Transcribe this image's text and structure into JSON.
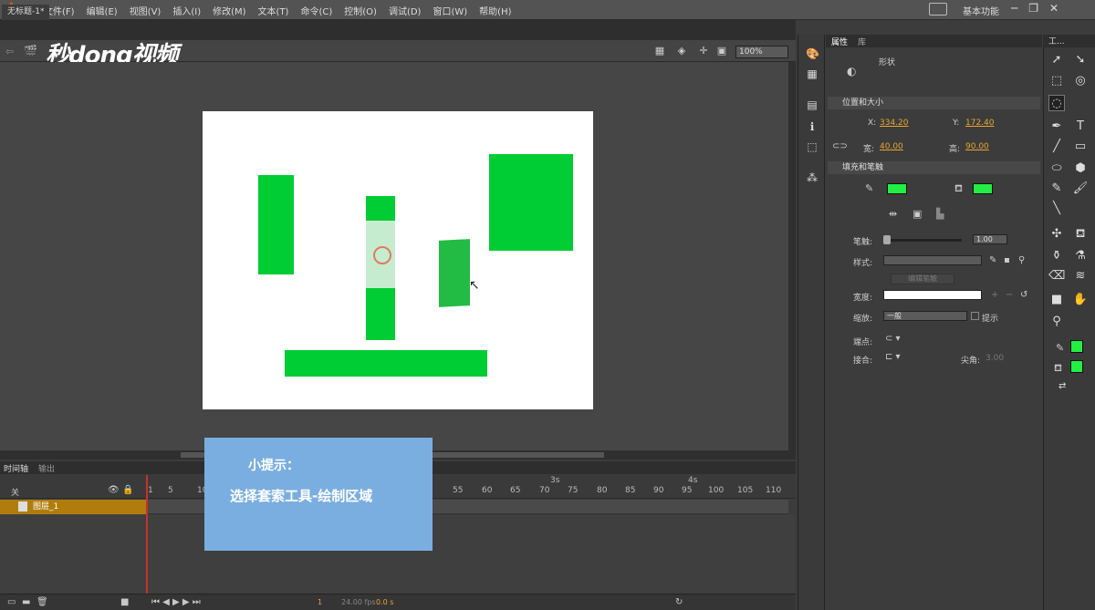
{
  "app": {
    "logo": "An"
  },
  "menu": [
    "文件(F)",
    "编辑(E)",
    "视图(V)",
    "插入(I)",
    "修改(M)",
    "文本(T)",
    "命令(C)",
    "控制(O)",
    "调试(D)",
    "窗口(W)",
    "帮助(H)"
  ],
  "workspace": {
    "label": "基本功能"
  },
  "document": {
    "tab": "无标题-1*",
    "watermark": "秒dong视频",
    "zoom": "100%"
  },
  "timeline": {
    "tabs": [
      "时间轴",
      "输出"
    ],
    "layer_name": "图层_1",
    "layer_head": "关",
    "ruler_labels": [
      "1",
      "5",
      "10",
      "55",
      "60",
      "65",
      "70",
      "75",
      "80",
      "85",
      "90",
      "95",
      "100",
      "105",
      "110"
    ],
    "time_markers": [
      "3s",
      "4s"
    ],
    "footer": {
      "frame": "1",
      "fps": "24.00 fps",
      "time": "0.0 s"
    }
  },
  "tip": {
    "title": "小提示：",
    "body": "选择套索工具-绘制区域"
  },
  "properties": {
    "tabs": [
      "属性",
      "库"
    ],
    "object_type": "形状",
    "section_position": "位置和大小",
    "x_label": "X:",
    "x_value": "334.20",
    "y_label": "Y:",
    "y_value": "172.40",
    "w_label": "宽:",
    "w_value": "40.00",
    "h_label": "高:",
    "h_value": "90.00",
    "section_fill": "填充和笔触",
    "stroke_label": "笔触:",
    "stroke_value": "1.00",
    "style_label": "样式:",
    "edit_style": "编辑笔触",
    "width_label": "宽度:",
    "scale_label": "缩放:",
    "scale_value": "一般",
    "hint_label": "提示",
    "cap_label": "端点:",
    "join_label": "接合:",
    "miter_label": "尖角:",
    "miter_value": "3.00",
    "fill_color": "#22ee44",
    "stroke_color": "#22ee44"
  },
  "tools": {
    "header": "工..."
  },
  "colors": {
    "shape_green": "#00cc33",
    "accent": "#e8a530"
  }
}
